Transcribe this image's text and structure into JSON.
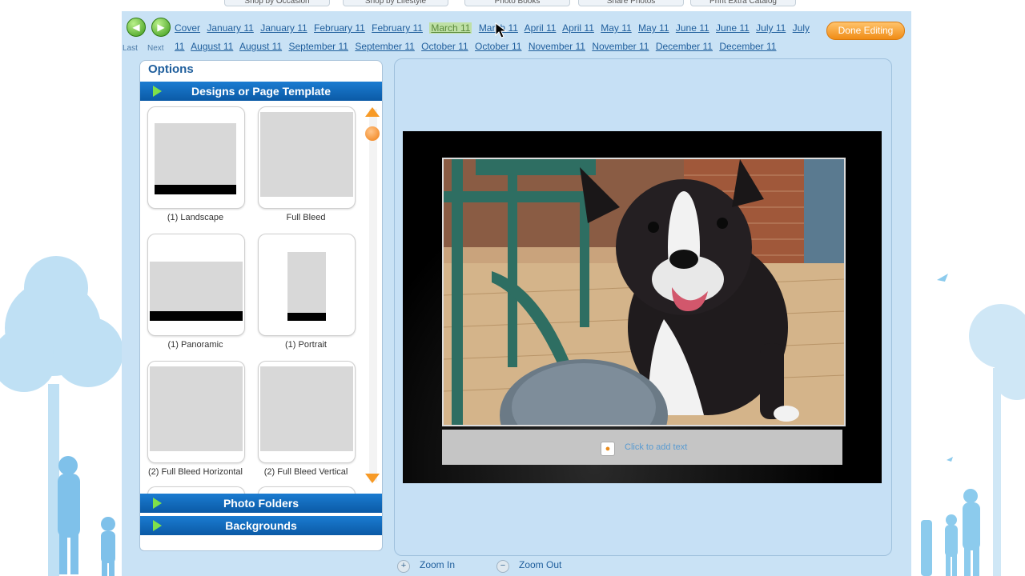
{
  "top_tabs": [
    "Shop by Occasion",
    "Shop by Lifestyle",
    "Photo Books",
    "Share Photos",
    "Print Extra Catalog"
  ],
  "nav": {
    "prev_label": "Last",
    "next_label": "Next",
    "prev_icon": "arrow-left-icon",
    "next_icon": "arrow-right-icon"
  },
  "page_links": [
    "Cover",
    "January 11",
    "January 11",
    "February 11",
    "February 11",
    "March 11",
    "March 11",
    "April 11",
    "April 11",
    "May 11",
    "May 11",
    "June 11",
    "June 11",
    "July 11",
    "July",
    "11",
    "August 11",
    "August 11",
    "September 11",
    "September 11",
    "October 11",
    "October 11",
    "November 11",
    "November 11",
    "December 11",
    "December 11"
  ],
  "active_page_index": 5,
  "done_button": "Done Editing",
  "options": {
    "title": "Options",
    "sections": {
      "designs": "Designs or Page Template",
      "photo_folders": "Photo Folders",
      "backgrounds": "Backgrounds"
    },
    "templates": [
      {
        "label": "(1) Landscape"
      },
      {
        "label": "Full Bleed"
      },
      {
        "label": "(1) Panoramic"
      },
      {
        "label": "(1) Portrait"
      },
      {
        "label": "(2) Full Bleed Horizontal"
      },
      {
        "label": "(2) Full Bleed Vertical"
      }
    ]
  },
  "caption": {
    "icon": "text-caption-icon",
    "text": "Click to add text"
  },
  "zoom": {
    "zoom_in": "Zoom In",
    "zoom_out": "Zoom Out"
  },
  "colors": {
    "app_background": "#c9e2f5",
    "section_bar": "#0b5aa6",
    "accent_orange": "#f08c15",
    "nav_green": "#3d9a1a"
  }
}
